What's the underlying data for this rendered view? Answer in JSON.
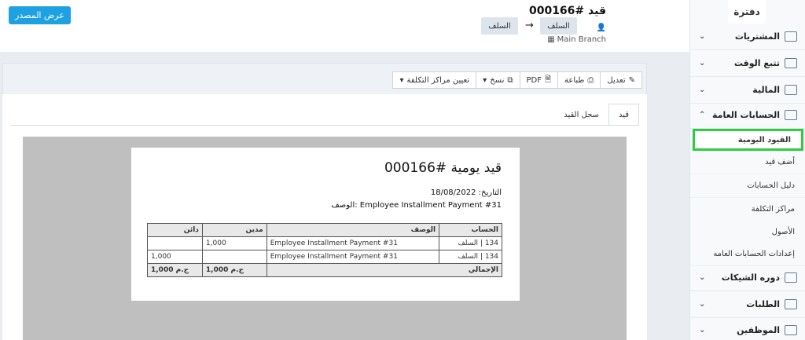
{
  "sidebar": {
    "logo": "دفترة",
    "items": [
      {
        "label": "المشتريات"
      },
      {
        "label": "تتبع الوقت"
      },
      {
        "label": "المالية"
      },
      {
        "label": "الحسابات العامة"
      },
      {
        "label": "دوره الشيكات"
      },
      {
        "label": "الطلبات"
      },
      {
        "label": "الموظفين"
      }
    ],
    "sub_items": [
      {
        "label": "القيود اليومية"
      },
      {
        "label": "أضف قيد"
      },
      {
        "label": "دليل الحسابات"
      },
      {
        "label": "مراكز التكلفة"
      },
      {
        "label": "الأصول"
      },
      {
        "label": "إعدادات الحسابات العامه"
      }
    ]
  },
  "header": {
    "source_button": "عرض المصدر",
    "title": "قيد #000166",
    "branch": "Main Branch",
    "tags": [
      "السلف",
      "السلف"
    ],
    "arrow": "→"
  },
  "toolbar": {
    "edit": "تعديل",
    "print": "طباعة",
    "pdf": "PDF",
    "copy": "نسخ",
    "cost_centers": "تعيين مراكز التكلفة"
  },
  "tabs": [
    "قيد",
    "سجل القيد"
  ],
  "document": {
    "title": "قيد يومية #000166",
    "date_line": "التاريخ: 18/08/2022",
    "desc_line": "الوصف: Employee Installment Payment #31",
    "headers": [
      "الحساب",
      "الوصف",
      "مدين",
      "دائن"
    ],
    "rows": [
      {
        "code": "134",
        "account": "السلف",
        "desc": "Employee Installment Payment #31",
        "debit": "1,000",
        "credit": ""
      },
      {
        "code": "134",
        "account": "السلف",
        "desc": "Employee Installment Payment #31",
        "debit": "",
        "credit": "1,000"
      }
    ],
    "total_label": "الإجمالي",
    "total_debit": "1,000 ج.م",
    "total_credit": "1,000 ج.م"
  }
}
